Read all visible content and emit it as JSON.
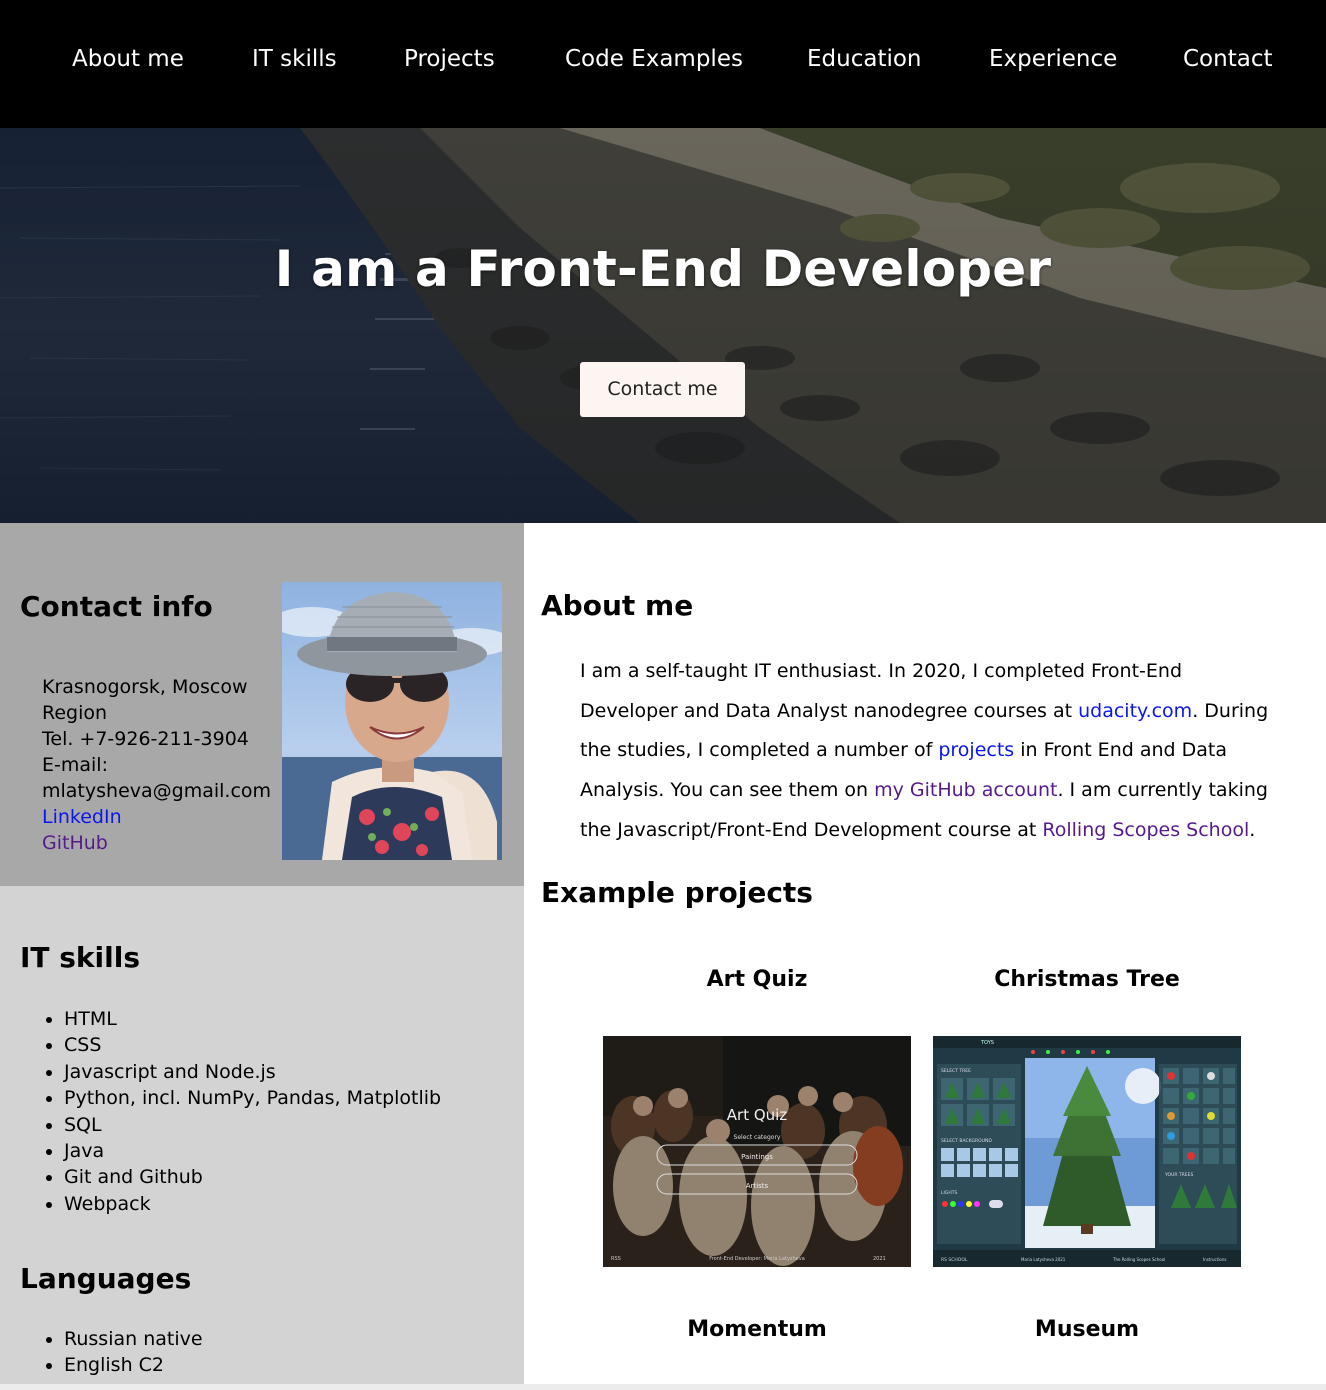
{
  "nav": {
    "items": [
      "About me",
      "IT skills",
      "Projects",
      "Code Examples",
      "Education",
      "Experience",
      "Contact"
    ]
  },
  "hero": {
    "title": "I am a Front-End Developer",
    "button_label": "Contact me"
  },
  "contact": {
    "heading": "Contact info",
    "location": "Krasnogorsk, Moscow Region",
    "phone": "Tel. +7-926-211-3904",
    "email_label": "E-mail:",
    "email": "mlatysheva@gmail.com",
    "linkedin": "LinkedIn",
    "github": "GitHub"
  },
  "skills": {
    "heading": "IT skills",
    "items": [
      "HTML",
      "CSS",
      "Javascript and Node.js",
      "Python, incl. NumPy, Pandas, Matplotlib",
      "SQL",
      "Java",
      "Git and Github",
      "Webpack"
    ]
  },
  "languages": {
    "heading": "Languages",
    "items": [
      "Russian native",
      "English C2"
    ]
  },
  "about": {
    "heading": "About me",
    "t1": "I am a self-taught IT enthusiast. In 2020, I completed Front-End Developer and Data Analyst nanodegree courses at ",
    "link_udacity": "udacity.com",
    "t2": ". During the studies, I completed a number of ",
    "link_projects": "projects",
    "t3": " in Front End and Data Analysis. You can see them on ",
    "link_github": "my GitHub account",
    "t4": ". I am currently taking the Javascript/Front-End Development course at ",
    "link_rss": "Rolling Scopes School",
    "t5": "."
  },
  "projects": {
    "heading": "Example projects",
    "items": [
      {
        "title": "Art Quiz",
        "thumb": {
          "title": "Art Quiz",
          "subtitle": "Select category",
          "option1": "Paintings",
          "option2": "Artists",
          "footer_left": "RSS",
          "footer_mid": "Front-End Developer: Maria Latysheva",
          "footer_right": "2021"
        }
      },
      {
        "title": "Christmas Tree",
        "thumb": {
          "top_label": "TOYS",
          "select_tree": "SELECT TREE",
          "select_bg": "SELECT BACKGROUND",
          "lights": "LIGHTS",
          "your_trees": "YOUR TREES",
          "footer_left": "RS SCHOOL",
          "footer_mid": "Maria Latysheva 2021",
          "footer_mid2": "The Rolling Scopes School",
          "footer_right": "Instructions"
        }
      },
      {
        "title": "Momentum"
      },
      {
        "title": "Museum"
      }
    ]
  },
  "colors": {
    "nav_bg": "#000000",
    "contact_bg": "#a9a8a9",
    "skills_bg": "#d3d3d3",
    "link": "#0a16ee",
    "link_visited": "#551a8b"
  }
}
